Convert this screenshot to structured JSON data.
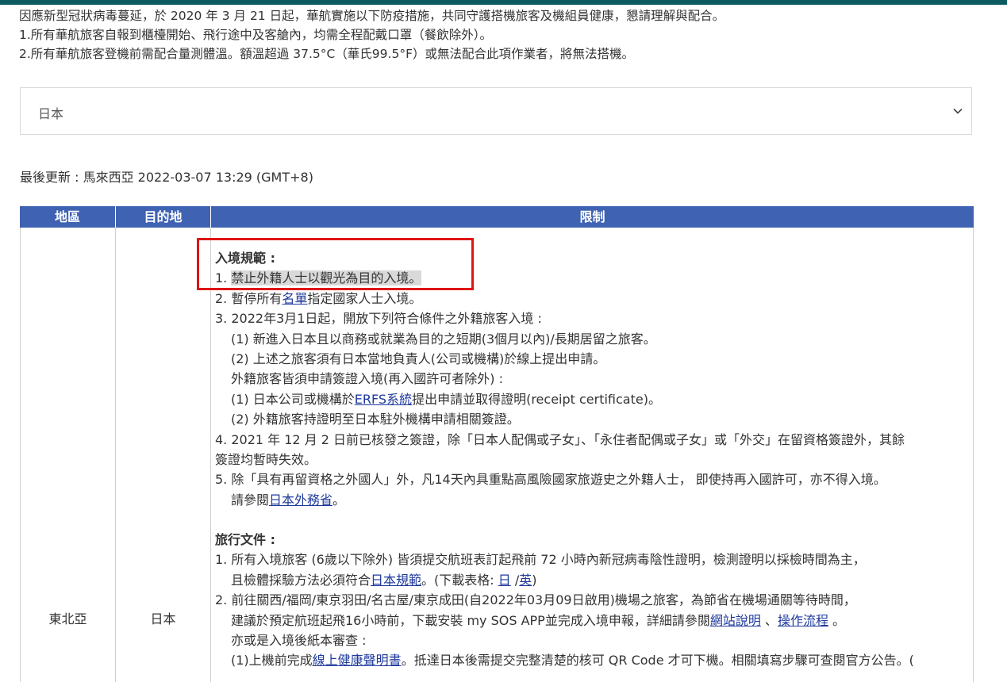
{
  "notice": {
    "line1": "因應新型冠狀病毒蔓延，於 2020 年 3 月 21 日起，華航實施以下防疫措施，共同守護搭機旅客及機組員健康，懇請理解與配合。",
    "line2": "1.所有華航旅客自報到櫃檯開始、飛行途中及客艙內，均需全程配戴口罩（餐飲除外）。",
    "line3": "2.所有華航旅客登機前需配合量測體溫。額溫超過 37.5°C（華氏99.5°F）或無法配合此項作業者，將無法搭機。"
  },
  "country_select": {
    "value": "日本",
    "icon": "chevron-down-icon"
  },
  "last_updated": "最後更新 : 馬來西亞 2022-03-07 13:29 (GMT+8)",
  "table": {
    "headers": {
      "region": "地區",
      "destination": "目的地",
      "restriction": "限制"
    },
    "row": {
      "region": "東北亞",
      "destination": "日本",
      "entry": {
        "heading": "入境規範 :",
        "item1_num": "1. ",
        "item1_text": "禁止外籍人士以觀光為目的入境。",
        "item2_pre": "2. 暫停所有",
        "item2_link": "名單",
        "item2_post": "指定國家人士入境。",
        "item3": "3. 2022年3月1日起，開放下列符合條件之外籍旅客入境 :",
        "item3_sub1": "(1) 新進入日本且以商務或就業為目的之短期(3個月以內)/長期居留之旅客。",
        "item3_sub2": "(2) 上述之旅客須有日本當地負責人(公司或機構)於線上提出申請。",
        "item3_visa": "外籍旅客皆須申請簽證入境(再入國許可者除外) :",
        "item3_visa1_pre": "(1) 日本公司或機構於",
        "item3_visa1_link": "ERFS系統",
        "item3_visa1_post": "提出申請並取得證明(receipt certificate)。",
        "item3_visa2": "(2) 外籍旅客持證明至日本駐外機構申請相關簽證。",
        "item4_line1": "4. 2021 年 12 月 2 日前已核發之簽證，除「日本人配偶或子女」、「永住者配偶或子女」或「外交」在留資格簽證外，其餘",
        "item4_line2": "簽證均暫時失效。",
        "item5": "5. 除「具有再留資格之外國人」外，凡14天內具重點高風險國家旅遊史之外籍人士， 即使持再入國許可，亦不得入境。",
        "item5_ref_pre": "請參閱",
        "item5_ref_link": "日本外務省",
        "item5_ref_post": "。"
      },
      "travel": {
        "heading": "旅行文件 :",
        "item1_line1": "1. 所有入境旅客 (6歲以下除外) 皆須提交航班表訂起飛前 72 小時內新冠病毒陰性證明，檢測證明以採檢時間為主，",
        "item1_line2_pre": "且檢體採驗方法必須符合",
        "item1_line2_link": "日本規範",
        "item1_line2_mid": "。(下載表格: ",
        "item1_link_ja": "日",
        "item1_sep": " /",
        "item1_link_en": "英",
        "item1_close": ")",
        "item2_line1": "2. 前往關西/福岡/東京羽田/名古屋/東京成田(自2022年03月09日啟用)機場之旅客，為節省在機場通關等待時間，",
        "item2_line2_pre": "建議於預定航班起飛16小時前，下載安裝 my SOS APP並完成入境申報，詳細請參閱",
        "item2_link1": "網站說明",
        "item2_sep": " 、",
        "item2_link2": "操作流程",
        "item2_line2_post": " 。",
        "item2_line3": "亦或是入境後紙本審查 :",
        "item2_line4_pre": "(1)上機前完成",
        "item2_line4_link": "線上健康聲明書",
        "item2_line4_post": "。抵達日本後需提交完整清楚的核可 QR Code 才可下機。相關填寫步驟可查閱官方公告。("
      }
    }
  },
  "colors": {
    "header_bg": "#3f63b2",
    "top_bar": "#0c5b63",
    "link": "#1f3a9e",
    "highlight_box": "#e01414"
  }
}
